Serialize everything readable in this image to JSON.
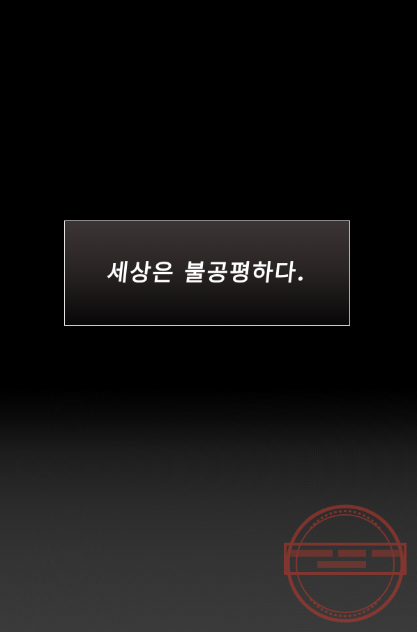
{
  "caption": {
    "text": "세상은 불공평하다."
  },
  "watermark": {
    "type": "stamp",
    "color": "#c0392b"
  },
  "colors": {
    "background_top": "#000000",
    "background_bottom": "#3a3a3a",
    "caption_border": "#e6e6e6",
    "caption_text": "#ffffff"
  }
}
